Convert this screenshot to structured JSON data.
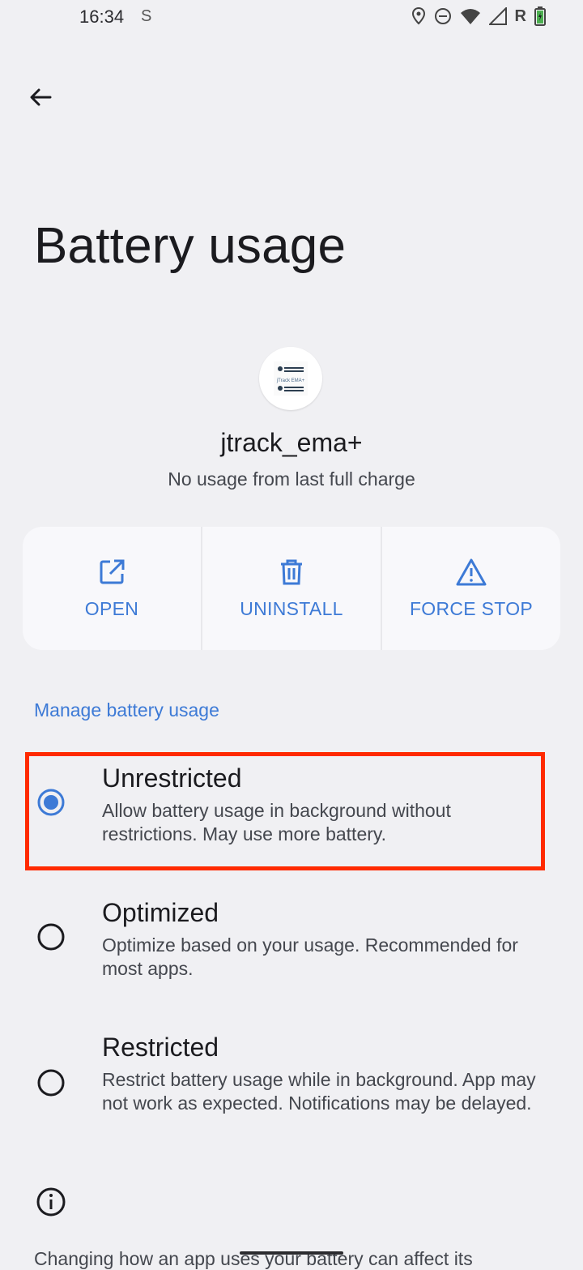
{
  "status_bar": {
    "time": "16:34",
    "s_glyph": "S",
    "roaming": "R",
    "icons": [
      "location-icon",
      "dnd-icon",
      "wifi-icon",
      "signal-icon",
      "battery-icon"
    ]
  },
  "header": {
    "back_icon": "arrow-back-icon",
    "title": "Battery usage"
  },
  "app": {
    "icon_text": "jTrack EMA+",
    "name": "jtrack_ema+",
    "summary": "No usage from last full charge"
  },
  "actions": [
    {
      "label": "OPEN",
      "icon": "open-external-icon"
    },
    {
      "label": "UNINSTALL",
      "icon": "trash-icon"
    },
    {
      "label": "FORCE STOP",
      "icon": "warning-icon"
    }
  ],
  "section": {
    "title": "Manage battery usage"
  },
  "options": [
    {
      "title": "Unrestricted",
      "description": "Allow battery usage in background without restrictions. May use more battery.",
      "selected": true
    },
    {
      "title": "Optimized",
      "description": "Optimize based on your usage. Recommended for most apps.",
      "selected": false
    },
    {
      "title": "Restricted",
      "description": "Restrict battery usage while in background. App may not work as expected. Notifications may be delayed.",
      "selected": false
    }
  ],
  "footer": {
    "info_icon": "info-icon",
    "text": "Changing how an app uses your battery can affect its"
  },
  "colors": {
    "accent": "#3d7ad6",
    "highlight": "#ff2a00",
    "background": "#f0f0f3"
  }
}
